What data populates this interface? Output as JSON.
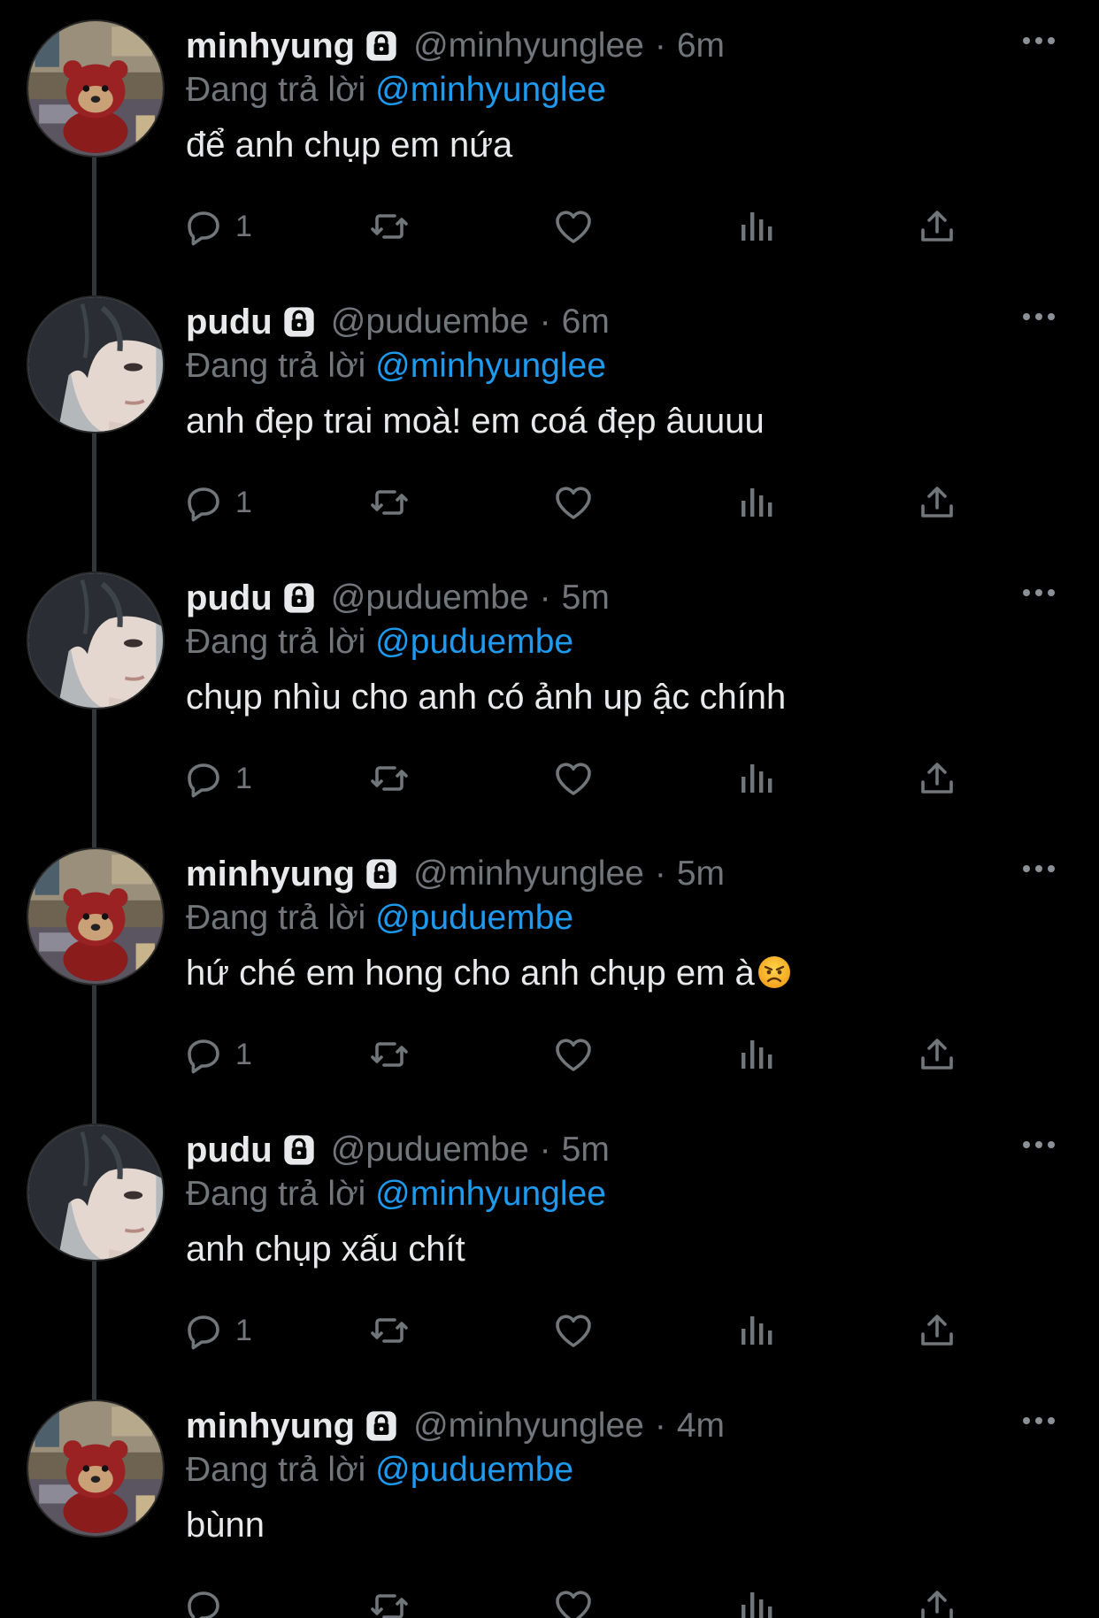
{
  "colors": {
    "background": "#000000",
    "text": "#e7e9ea",
    "muted": "#71767b",
    "mention": "#1d9bf0",
    "thread_line": "#333639"
  },
  "icons": {
    "lock": "lock-icon",
    "more": "more-horizontal-icon",
    "reply": "reply-bubble-icon",
    "retweet": "retweet-icon",
    "like": "heart-icon",
    "views": "views-bar-chart-icon",
    "share": "share-upload-icon"
  },
  "tweets": [
    {
      "avatar": "teddy-bear-avatar",
      "name": "minhyung",
      "handle": "@minhyunglee",
      "dot": "·",
      "time": "6m",
      "replying_prefix": "Đang trả lời",
      "replying_to": "@minhyunglee",
      "text": "để anh chụp em nứa",
      "reply_count": "1"
    },
    {
      "avatar": "boy-portrait-avatar",
      "name": "pudu",
      "handle": "@puduembe",
      "dot": "·",
      "time": "6m",
      "replying_prefix": "Đang trả lời",
      "replying_to": "@minhyunglee",
      "text": "anh đẹp trai moà! em coá đẹp âuuuu",
      "reply_count": "1"
    },
    {
      "avatar": "boy-portrait-avatar",
      "name": "pudu",
      "handle": "@puduembe",
      "dot": "·",
      "time": "5m",
      "replying_prefix": "Đang trả lời",
      "replying_to": "@puduembe",
      "text": "chụp nhìu cho anh có ảnh up ậc chính",
      "reply_count": "1"
    },
    {
      "avatar": "teddy-bear-avatar",
      "name": "minhyung",
      "handle": "@minhyunglee",
      "dot": "·",
      "time": "5m",
      "replying_prefix": "Đang trả lời",
      "replying_to": "@puduembe",
      "text": "hứ ché em hong cho anh chụp em à",
      "emoji": "angry-face-emoji",
      "reply_count": "1"
    },
    {
      "avatar": "boy-portrait-avatar",
      "name": "pudu",
      "handle": "@puduembe",
      "dot": "·",
      "time": "5m",
      "replying_prefix": "Đang trả lời",
      "replying_to": "@minhyunglee",
      "text": "anh chụp xấu chít",
      "reply_count": "1"
    },
    {
      "avatar": "teddy-bear-avatar",
      "name": "minhyung",
      "handle": "@minhyunglee",
      "dot": "·",
      "time": "4m",
      "replying_prefix": "Đang trả lời",
      "replying_to": "@puduembe",
      "text": "bùnn",
      "reply_count": ""
    }
  ]
}
